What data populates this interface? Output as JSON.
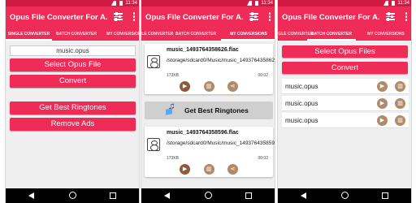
{
  "status": {
    "time": "11:34"
  },
  "app_title": "Opus File Converter For A...",
  "tabs": [
    "SINGLE CONVERTER",
    "BATCH CONVERTER",
    "MY CONVERSIONS"
  ],
  "screen1": {
    "file_field": "music.opus",
    "select_label": "Select Opus File",
    "convert_label": "Convert",
    "ringtones_label": "Get Best Ringtones",
    "remove_ads_label": "Remove Ads"
  },
  "screen2": {
    "cards": [
      {
        "name": "music_1493764358626.flac",
        "path": "/storage/sdcard0/Music/music_1493764358626.flac",
        "size": "173KB",
        "duration": "00:02"
      },
      {
        "name": "music_1493764358596.flac",
        "path": "/storage/sdcard0/Music/music_1493764358596.flac",
        "size": "173KB",
        "duration": "00:02"
      }
    ],
    "ringtones_label": "Get Best Ringtones"
  },
  "screen3": {
    "select_label": "Select Opus Files",
    "convert_label": "Convert",
    "files": [
      "music.opus",
      "music.opus",
      "music.opus"
    ]
  },
  "icons": {
    "play": "play-icon",
    "delete": "delete-icon",
    "share": "share-icon",
    "tune": "tune-icon",
    "more": "more-vert-icon"
  },
  "colors": {
    "primary": "#ef2b58",
    "status": "#cf1b43",
    "action": "#8b5a3c"
  }
}
